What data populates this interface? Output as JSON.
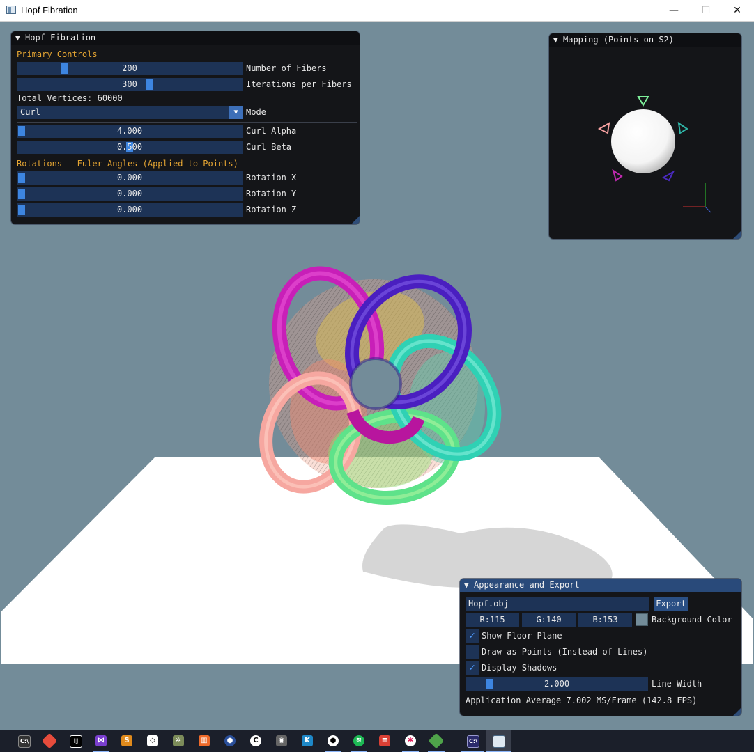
{
  "window": {
    "title": "Hopf Fibration",
    "minimize": "—",
    "maximize": "☐",
    "close": "✕"
  },
  "panel_main": {
    "title": "Hopf Fibration",
    "primary_section": "Primary Controls",
    "fibers": {
      "value": "200",
      "label": "Number of Fibers",
      "fraction": 0.2
    },
    "iterations": {
      "value": "300",
      "label": "Iterations per Fibers",
      "fraction": 0.58
    },
    "total_vertices": "Total Vertices: 60000",
    "mode": {
      "value": "Curl",
      "label": "Mode"
    },
    "curl_alpha": {
      "value": "4.000",
      "label": "Curl Alpha",
      "fraction": 0.0
    },
    "curl_beta": {
      "value": "0.500",
      "label": "Curl Beta",
      "fraction": 0.5
    },
    "rotation_section": "Rotations - Euler Angles (Applied to Points)",
    "rot_x": {
      "value": "0.000",
      "label": "Rotation X",
      "fraction": 0.0
    },
    "rot_y": {
      "value": "0.000",
      "label": "Rotation Y",
      "fraction": 0.0
    },
    "rot_z": {
      "value": "0.000",
      "label": "Rotation Z",
      "fraction": 0.0
    }
  },
  "panel_mapping": {
    "title": "Mapping (Points on S2)"
  },
  "panel_export": {
    "title": "Appearance and Export",
    "filename": "Hopf.obj",
    "export_label": "Export",
    "r": "R:115",
    "g": "G:140",
    "b": "B:153",
    "bg_label": "Background Color",
    "background_color": "#738c99",
    "show_floor": {
      "label": "Show Floor Plane",
      "checked": true
    },
    "draw_points": {
      "label": "Draw as Points (Instead of Lines)",
      "checked": false
    },
    "display_shadows": {
      "label": "Display Shadows",
      "checked": true
    },
    "line_width": {
      "value": "2.000",
      "label": "Line Width",
      "fraction": 0.12
    },
    "fps": "Application Average 7.002 MS/Frame (142.8 FPS)"
  },
  "taskbar": {
    "icons": [
      "console-icon",
      "git-icon",
      "jetbrains-icon",
      "visual-studio-icon",
      "sublime-icon",
      "unity-icon",
      "tool-icon",
      "ableton-icon",
      "blender-icon",
      "ccleaner-icon",
      "gimp-icon",
      "krita-icon",
      "github-icon",
      "spotify-icon",
      "todoist-icon",
      "slack-icon",
      "git-extensions-icon",
      "terminal-icon",
      "hopf-app-icon"
    ]
  }
}
